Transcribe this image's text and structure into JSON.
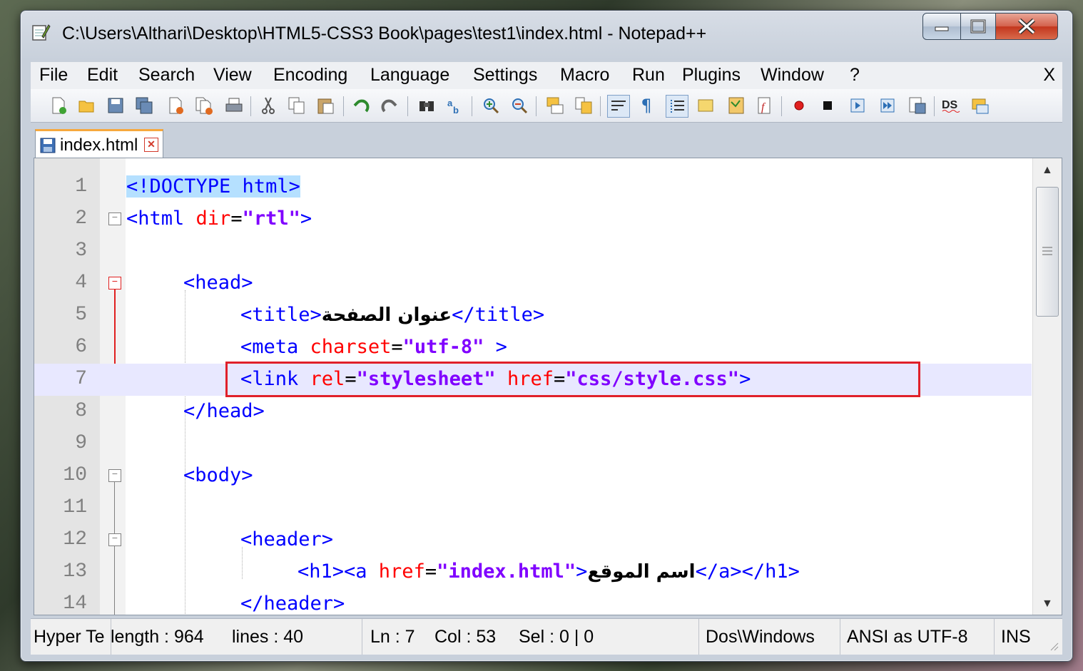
{
  "window": {
    "title": "C:\\Users\\Althari\\Desktop\\HTML5-CSS3 Book\\pages\\test1\\index.html - Notepad++"
  },
  "menu": {
    "items": [
      "File",
      "Edit",
      "Search",
      "View",
      "Encoding",
      "Language",
      "Settings",
      "Macro",
      "Run",
      "Plugins",
      "Window",
      "?"
    ],
    "close_label": "X"
  },
  "toolbar": {
    "icons": [
      "new-file-icon",
      "open-file-icon",
      "save-icon",
      "save-all-icon",
      "close-icon",
      "close-all-icon",
      "print-icon",
      "cut-icon",
      "copy-icon",
      "paste-icon",
      "undo-icon",
      "redo-icon",
      "find-icon",
      "replace-icon",
      "zoom-in-icon",
      "zoom-out-icon",
      "sync-vertical-icon",
      "sync-horizontal-icon",
      "word-wrap-icon",
      "show-all-chars-icon",
      "indent-guide-icon",
      "user-language-icon",
      "doc-map-icon",
      "function-list-icon",
      "record-macro-icon",
      "stop-macro-icon",
      "play-macro-icon",
      "run-macro-multiple-icon",
      "save-macro-icon",
      "spell-check-icon",
      "compare-icon"
    ]
  },
  "tab": {
    "label": "index.html"
  },
  "editor": {
    "lines": [
      {
        "num": "1"
      },
      {
        "num": "2"
      },
      {
        "num": "3"
      },
      {
        "num": "4"
      },
      {
        "num": "5"
      },
      {
        "num": "6"
      },
      {
        "num": "7"
      },
      {
        "num": "8"
      },
      {
        "num": "9"
      },
      {
        "num": "10"
      },
      {
        "num": "11"
      },
      {
        "num": "12"
      },
      {
        "num": "13"
      },
      {
        "num": "14"
      }
    ],
    "code": {
      "l1_doctype": "<!DOCTYPE html>",
      "l2_tag": "<html ",
      "l2_attr": "dir",
      "l2_val": "\"rtl\"",
      "l4": "<head>",
      "l5_open": "<title>",
      "l5_text": "عنوان الصفحة",
      "l5_close": "</title>",
      "l6_tag": "<meta ",
      "l6_attr": "charset",
      "l6_val": "\"utf-8\"",
      "l6_end": " >",
      "l7_tag": "<link ",
      "l7_attr1": "rel",
      "l7_val1": "\"stylesheet\"",
      "l7_attr2": "href",
      "l7_val2": "\"css/style.css\"",
      "l8": "</head>",
      "l10": "<body>",
      "l12": "<header>",
      "l13_tag": "<h1><a ",
      "l13_attr": "href",
      "l13_val": "\"index.html\"",
      "l13_text": "اسم الموقع",
      "l13_close": "</a></h1>",
      "l14": "</header>"
    }
  },
  "status": {
    "filetype": "Hyper Te",
    "length": "length : 964",
    "lines": "lines : 40",
    "ln": "Ln : 7",
    "col": "Col : 53",
    "sel": "Sel : 0 | 0",
    "eol": "Dos\\Windows",
    "encoding": "ANSI as UTF-8",
    "mode": "INS"
  }
}
